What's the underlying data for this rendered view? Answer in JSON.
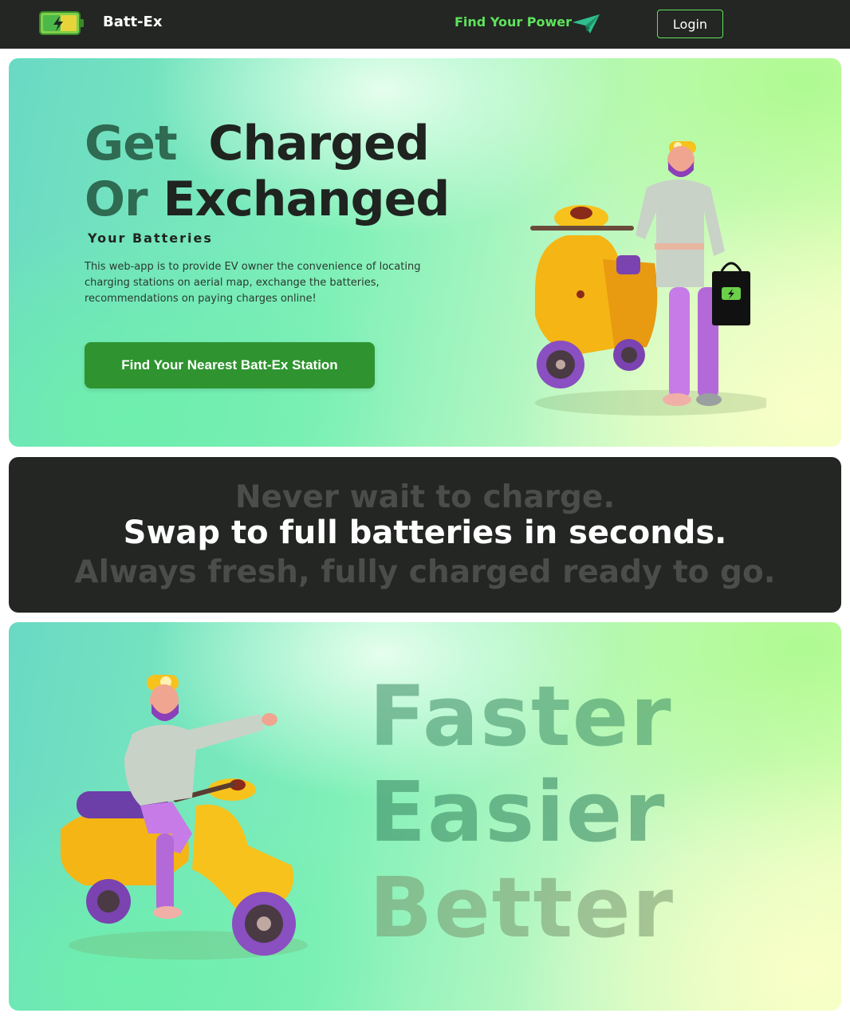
{
  "nav": {
    "brand": "Batt-Ex",
    "link": "Find Your Power",
    "login": "Login",
    "logo_icon": "battery-charging-icon",
    "link_icon": "paper-plane-icon"
  },
  "hero": {
    "title_line1_a": "Get",
    "title_line1_b": "Charged",
    "title_line2_a": "Or",
    "title_line2_b": "Exchanged",
    "subtitle": "Your Batteries",
    "description": "This web-app is to provide EV owner the convenience of locating charging stations on aerial map, exchange the batteries, recommendations on paying charges online!",
    "cta": "Find Your Nearest Batt-Ex Station"
  },
  "band": {
    "line1": "Never wait to charge.",
    "line2": "Swap to full batteries in seconds.",
    "line3": "Always fresh, fully charged ready to go."
  },
  "features": {
    "word1": "Faster",
    "word2": "Easier",
    "word3": "Better"
  },
  "colors": {
    "nav_bg": "#232623",
    "accent_green": "#5fe35c",
    "cta_green": "#2f9430",
    "scooter_yellow": "#f5b514",
    "purple": "#9b5fc7"
  }
}
